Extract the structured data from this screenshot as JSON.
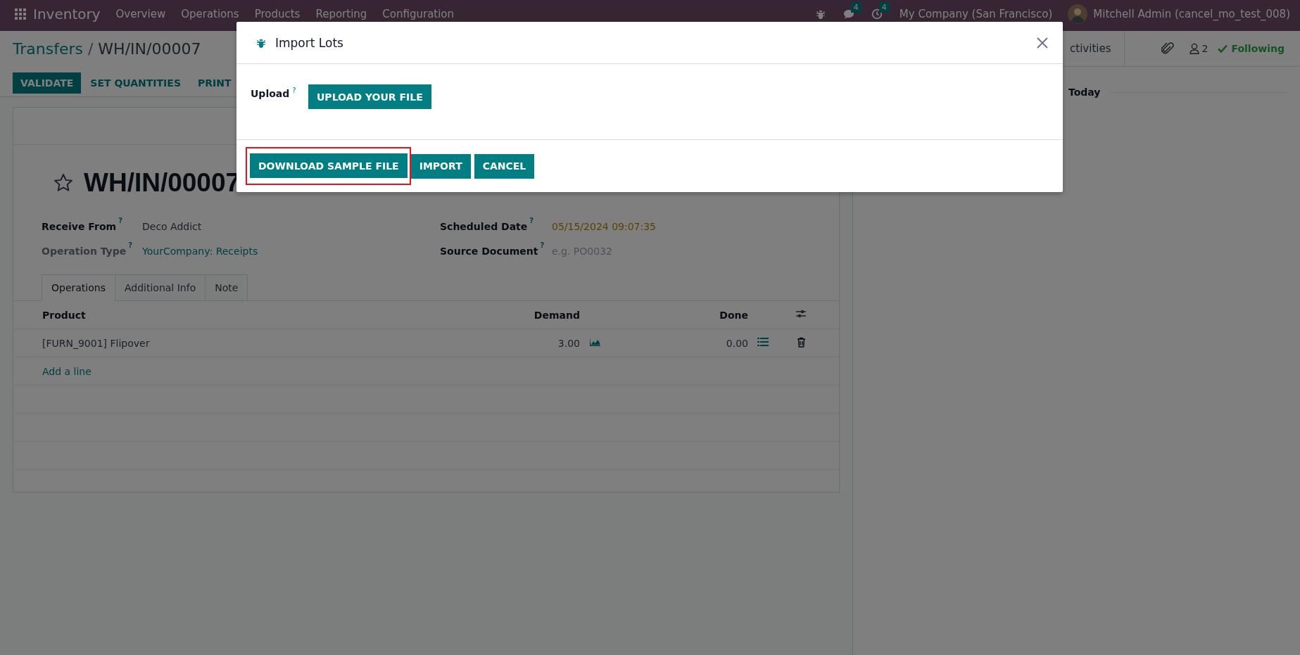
{
  "navbar": {
    "app": "Inventory",
    "menu": [
      "Overview",
      "Operations",
      "Products",
      "Reporting",
      "Configuration"
    ],
    "systray": [
      {
        "kind": "debug"
      },
      {
        "kind": "chat",
        "badge": "4"
      },
      {
        "kind": "clock",
        "badge": "4"
      }
    ],
    "company": "My Company (San Francisco)",
    "user": "Mitchell Admin (cancel_mo_test_008)"
  },
  "breadcrumb": {
    "parent": "Transfers",
    "separator": "/",
    "current": "WH/IN/00007"
  },
  "actions": [
    {
      "label": "VALIDATE",
      "kind": "primary"
    },
    {
      "label": "SET QUANTITIES",
      "kind": "secondary"
    },
    {
      "label": "PRINT",
      "kind": "secondary"
    }
  ],
  "form": {
    "title": "WH/IN/00007",
    "starred": false,
    "fields": [
      {
        "label": "Receive From",
        "help": "?",
        "value": "Deco Addict",
        "kind": "text",
        "muted": false
      },
      {
        "label": "Scheduled Date",
        "help": "?",
        "value": "05/15/2024 09:07:35",
        "kind": "warning",
        "muted": false
      },
      {
        "label": "Operation Type",
        "help": "?",
        "value": "YourCompany: Receipts",
        "kind": "link",
        "muted": true
      },
      {
        "label": "Source Document",
        "help": "?",
        "placeholder": "e.g. PO0032",
        "kind": "placeholder",
        "muted": false
      }
    ],
    "tabs": [
      {
        "label": "Operations",
        "selected": true
      },
      {
        "label": "Additional Info",
        "selected": false
      },
      {
        "label": "Note",
        "selected": false
      }
    ],
    "table": {
      "columns": [
        "Product",
        "Demand",
        "Done"
      ],
      "rows": [
        {
          "product": "[FURN_9001] Flipover",
          "demand": "3.00",
          "done": "0.00"
        }
      ],
      "add_line": "Add a line"
    }
  },
  "chatter": {
    "activities": "ctivities",
    "followers": "2",
    "following": "Following",
    "following_on": true,
    "date_separator": "Today"
  },
  "dialog": {
    "title": "Import Lots",
    "upload_label": "Upload",
    "upload_help": "?",
    "upload_button": "UPLOAD YOUR FILE",
    "buttons": [
      {
        "label": "DOWNLOAD SAMPLE FILE",
        "highlighted": true
      },
      {
        "label": "IMPORT",
        "highlighted": false
      },
      {
        "label": "CANCEL",
        "highlighted": false
      }
    ]
  }
}
